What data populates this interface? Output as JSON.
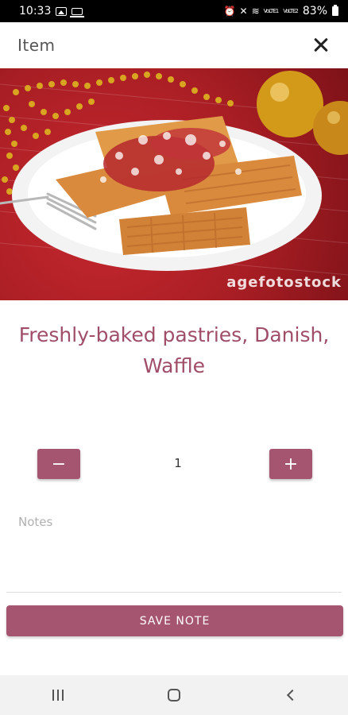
{
  "status_bar": {
    "time": "10:33",
    "icons_left": [
      "image-icon",
      "laptop-icon"
    ],
    "icons_right": [
      "alarm-icon",
      "mute-icon",
      "wifi-icon",
      "signal-icon",
      "signal-icon",
      "battery-icon"
    ],
    "network_label_1": "VoLTE1",
    "network_label_2": "VoLTE2",
    "battery": "83%"
  },
  "header": {
    "title": "Item"
  },
  "item": {
    "name": "Freshly-baked pastries, Danish, Waffle",
    "image_watermark": "agefotostock"
  },
  "quantity": {
    "minus_label": "−",
    "value": "1",
    "plus_label": "+"
  },
  "notes": {
    "placeholder": "Notes",
    "value": ""
  },
  "actions": {
    "save_label": "SAVE NOTE"
  },
  "colors": {
    "accent": "#a65570",
    "title": "#a04e68",
    "background": "#ffffff"
  }
}
